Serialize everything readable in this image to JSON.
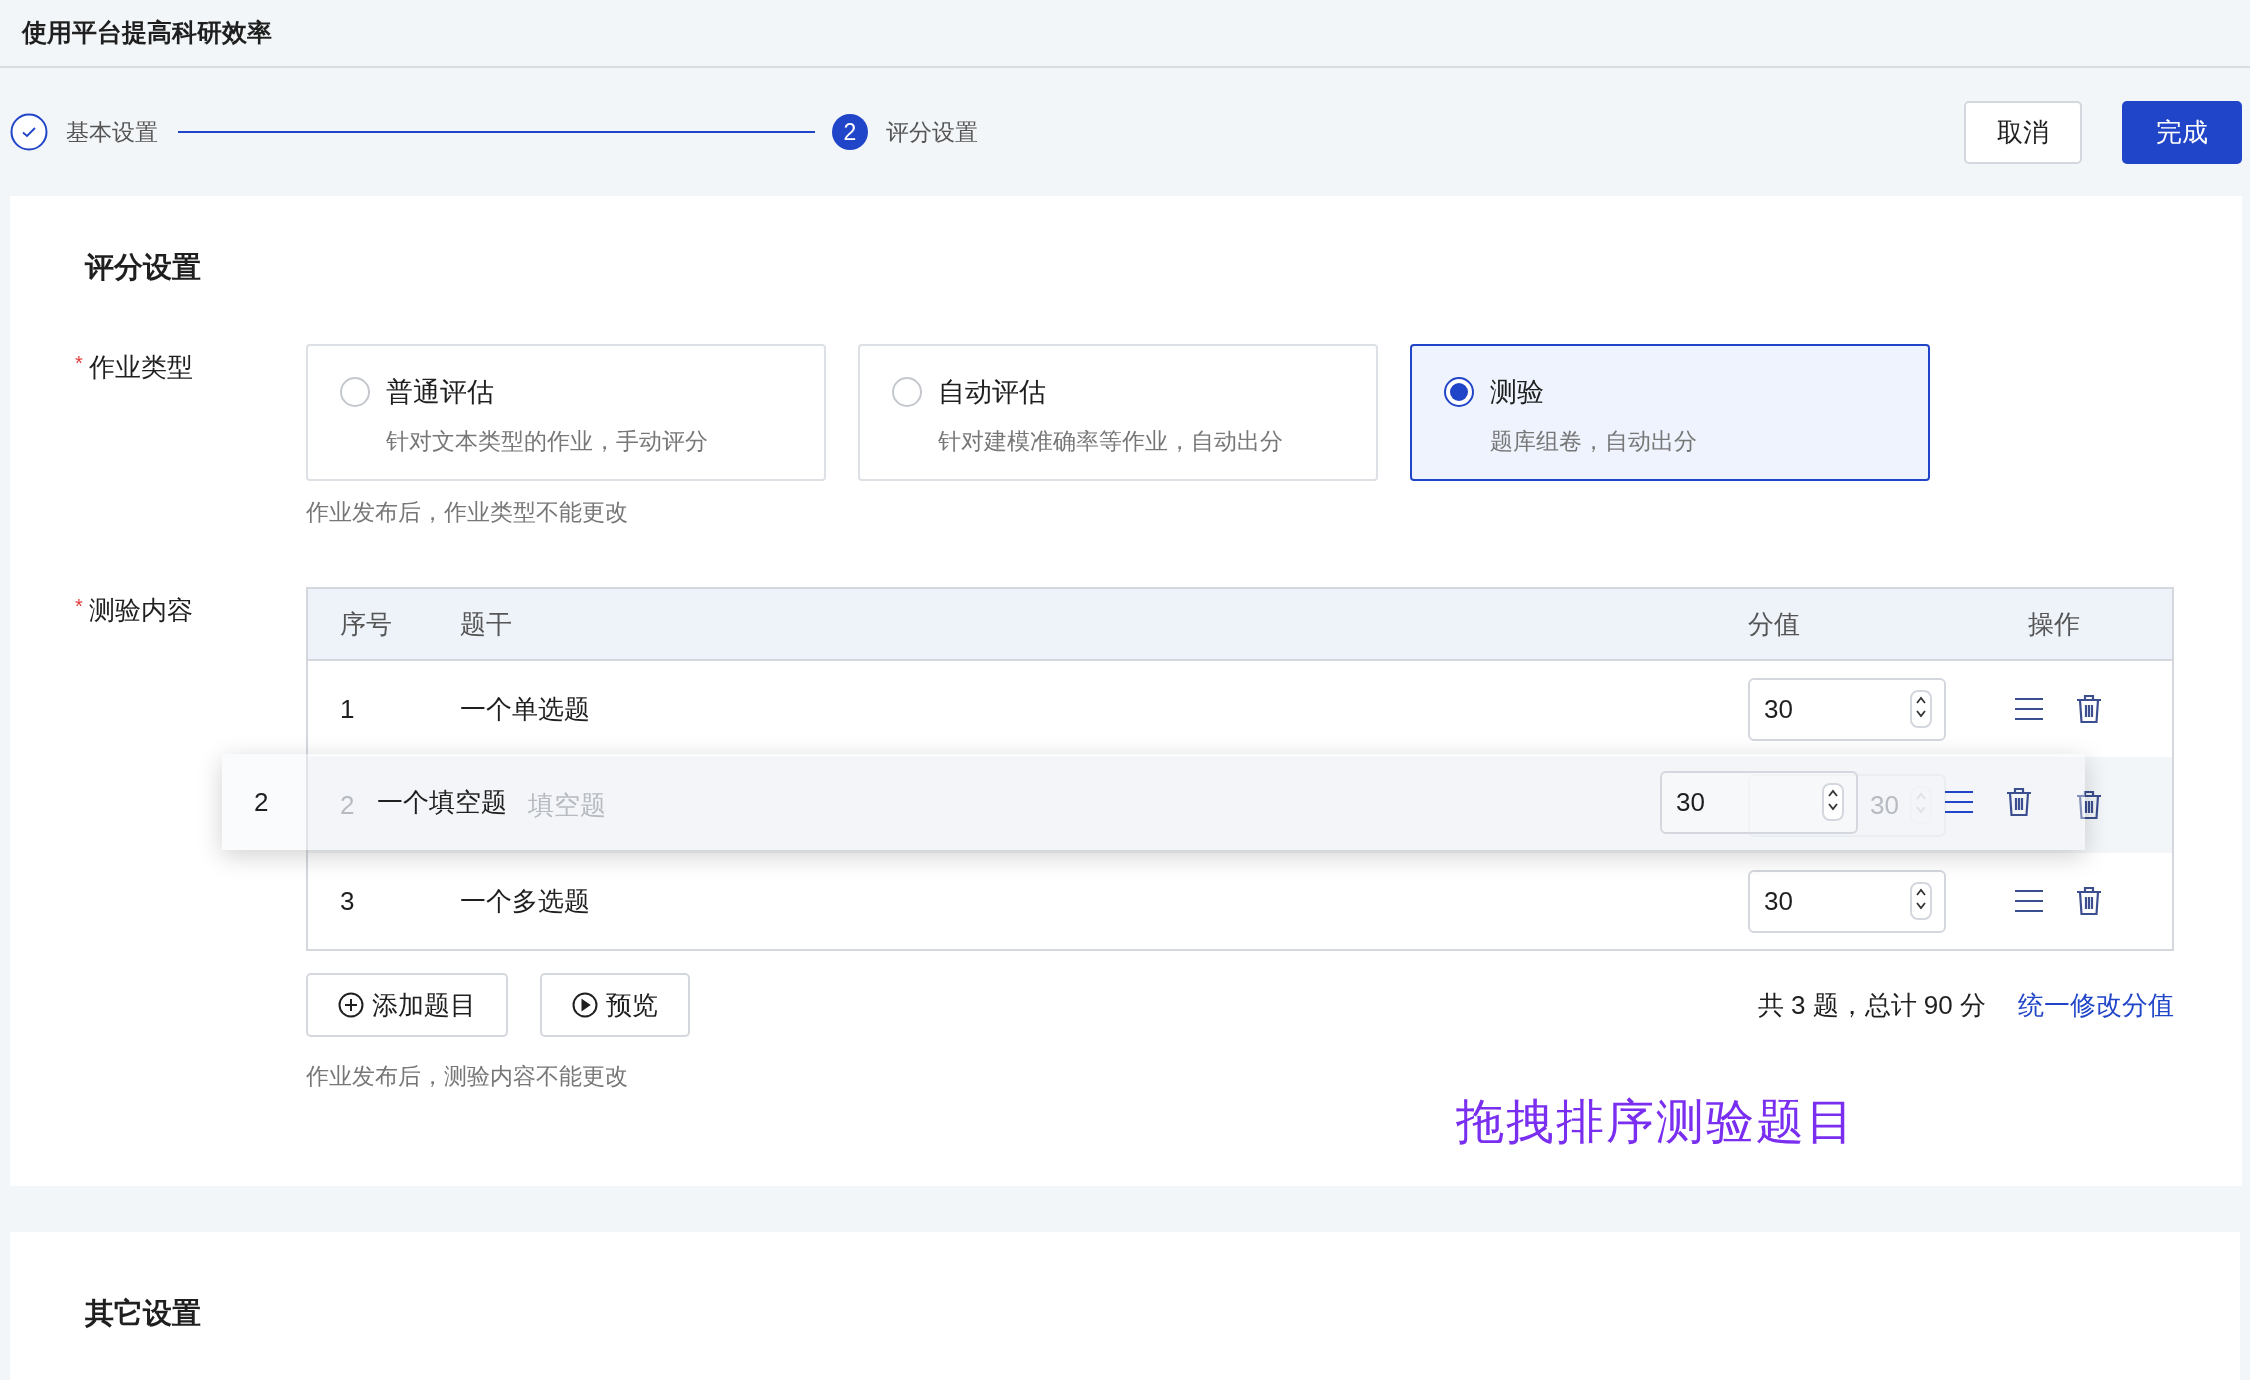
{
  "header": {
    "title": "使用平台提高科研效率"
  },
  "steps": [
    {
      "label": "基本设置",
      "done": true
    },
    {
      "label": "评分设置",
      "done": false,
      "index": "2"
    }
  ],
  "actions": [
    {
      "label": "取消",
      "kind": "secondary"
    },
    {
      "label": "完成",
      "kind": "primary"
    }
  ],
  "scoring": {
    "title": "评分设置",
    "type_field": {
      "label": "作业类型",
      "required_mark": "*",
      "options": [
        {
          "title": "普通评估",
          "desc": "针对文本类型的作业，手动评分",
          "selected": false
        },
        {
          "title": "自动评估",
          "desc": "针对建模准确率等作业，自动出分",
          "selected": false
        },
        {
          "title": "测验",
          "desc": "题库组卷，自动出分",
          "selected": true
        }
      ],
      "hint": "作业发布后，作业类型不能更改"
    },
    "quiz_field": {
      "label": "测验内容",
      "required_mark": "*",
      "columns": [
        "序号",
        "题干",
        "分值",
        "操作"
      ],
      "rows": [
        {
          "index": "1",
          "title": "一个单选题",
          "score": "30",
          "kind": "normal"
        },
        {
          "index": "2",
          "title": "填空题",
          "score": "30",
          "kind": "placeholder"
        },
        {
          "index": "3",
          "title": "一个多选题",
          "score": "30",
          "kind": "normal"
        }
      ],
      "dragged_row": {
        "index": "2",
        "title": "一个填空题",
        "score": "30"
      },
      "buttons": [
        "添加题目",
        "预览"
      ],
      "summary": "共 3 题，总计 90 分",
      "link": "统一修改分值",
      "hint": "作业发布后，测验内容不能更改"
    },
    "annotation": "拖拽排序测验题目"
  },
  "other": {
    "title": "其它设置"
  }
}
